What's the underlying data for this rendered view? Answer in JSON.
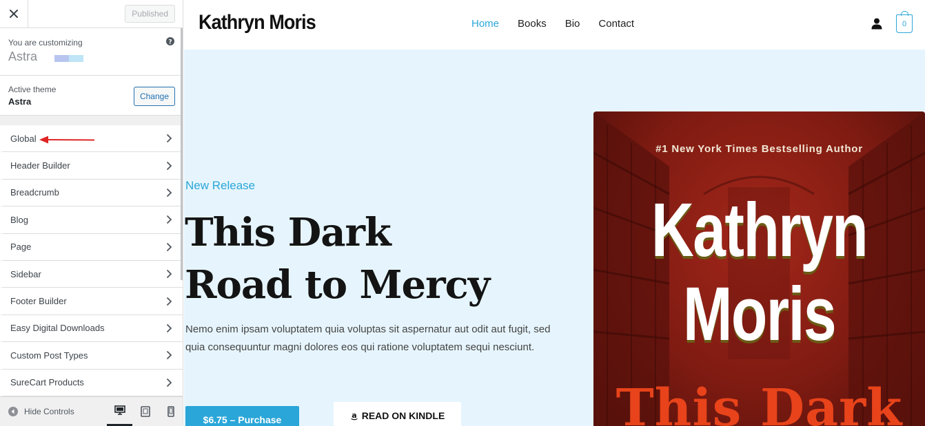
{
  "customizer": {
    "publish_label": "Published",
    "customizing_label": "You are customizing",
    "customizing_site": "Astra",
    "active_theme_label": "Active theme",
    "active_theme_name": "Astra",
    "change_label": "Change",
    "menu": [
      {
        "label": "Global"
      },
      {
        "label": "Header Builder"
      },
      {
        "label": "Breadcrumb"
      },
      {
        "label": "Blog"
      },
      {
        "label": "Page"
      },
      {
        "label": "Sidebar"
      },
      {
        "label": "Footer Builder"
      },
      {
        "label": "Easy Digital Downloads"
      },
      {
        "label": "Custom Post Types"
      },
      {
        "label": "SureCart Products"
      }
    ],
    "hide_controls_label": "Hide Controls",
    "colors": {
      "accent": "#2271b1",
      "annotation_arrow": "#e02424"
    }
  },
  "site": {
    "title": "Kathryn Moris",
    "nav": [
      {
        "label": "Home",
        "active": true
      },
      {
        "label": "Books"
      },
      {
        "label": "Bio"
      },
      {
        "label": "Contact"
      }
    ],
    "cart_count": "0",
    "hero": {
      "tag": "New Release",
      "title_line1": "This Dark",
      "title_line2": "Road to Mercy",
      "text": "Nemo enim ipsam voluptatem quia voluptas sit aspernatur aut odit aut fugit, sed quia consequuntur magni dolores eos qui ratione voluptatem sequi nesciunt.",
      "buy_label": "$6.75 – Purchase",
      "kindle_label": "READ ON KINDLE"
    },
    "book": {
      "tagline": "#1 New York Times Bestselling Author",
      "author_line1": "Kathryn",
      "author_line2": "Moris",
      "title_partial": "This Dark"
    },
    "colors": {
      "accent": "#2aa6d8",
      "hero_bg": "#e6f5fd"
    }
  }
}
